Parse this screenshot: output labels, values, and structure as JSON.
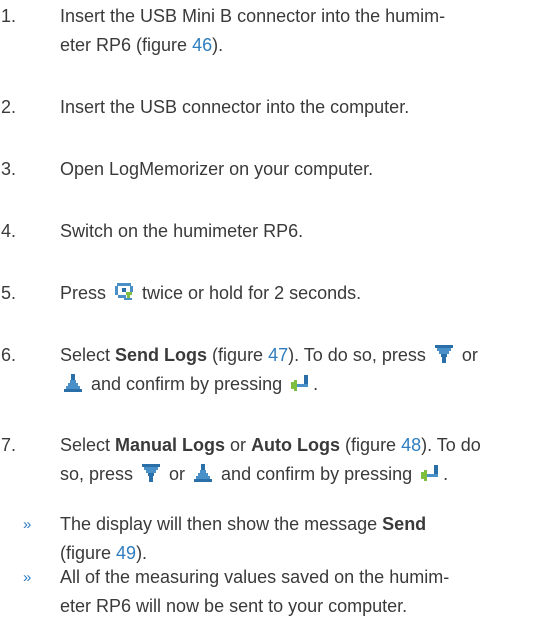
{
  "steps": [
    {
      "num": "1.",
      "pre": "Insert the USB Mini B connector into the humim-",
      "line2": "eter RP6 (figure ",
      "fig": "46",
      "post": ")."
    },
    {
      "num": "2.",
      "text": "Insert the USB connector into the computer."
    },
    {
      "num": "3.",
      "text": "Open LogMemorizer on your computer."
    },
    {
      "num": "4.",
      "text": "Switch on the humimeter RP6."
    },
    {
      "num": "5.",
      "pre": "Press ",
      "post": " twice or hold for 2 seconds."
    },
    {
      "num": "6.",
      "pre": "Select ",
      "bold": "Send Logs",
      "mid": " (figure ",
      "fig": "47",
      "post": "). To do so, press ",
      "or": " or",
      "line2": " and confirm by pressing ",
      "end": "."
    },
    {
      "num": "7.",
      "pre": "Select ",
      "bold1": "Manual Logs",
      "or1": " or ",
      "bold2": "Auto Logs",
      "mid": " (figure ",
      "fig": "48",
      "post": "). To do",
      "line2a": "so, press ",
      "or2": " or ",
      "line2b": " and confirm by pressing ",
      "end": "."
    }
  ],
  "notes": [
    {
      "marker": "»",
      "pre": "The display will then show the message ",
      "bold": "Send",
      "line2": "(figure ",
      "fig": "49",
      "post": ")."
    },
    {
      "marker": "»",
      "line1": "All of the measuring values saved on the humim-",
      "line2": "eter RP6 will now be sent to your computer."
    }
  ],
  "icons": {
    "start": "rotate-start-icon",
    "down": "arrow-down-icon",
    "up": "arrow-up-icon",
    "enter": "enter-icon",
    "icon_color": "#1f6fb3"
  }
}
